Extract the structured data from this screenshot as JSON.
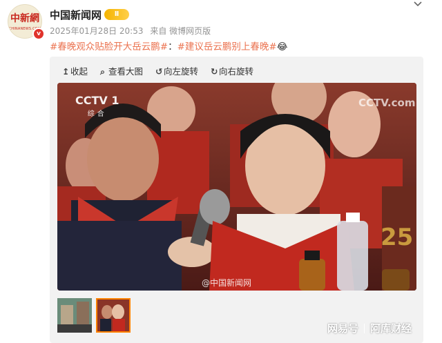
{
  "account": {
    "avatar_text": "中新網",
    "avatar_sub": "CHINANEWS.COM",
    "verified_mark": "v",
    "name": "中国新闻网",
    "member_badge": "Ⅱ",
    "timestamp": "2025年01月28日 20:53",
    "source": "来自 微博网页版"
  },
  "post": {
    "tag1": "#春晚观众贴脸开大岳云鹏#",
    "colon": "：",
    "tag2": "#建议岳云鹏别上春晚#",
    "emoji": "😂"
  },
  "toolbar": {
    "collapse_icon": "↥",
    "collapse_label": "收起",
    "view_large_icon": "⌕",
    "view_large_label": "查看大图",
    "rotate_left_icon": "↺",
    "rotate_left_label": "向左旋转",
    "rotate_right_icon": "↻",
    "rotate_right_label": "向右旋转"
  },
  "photo": {
    "channel_logo": "CCTV 1",
    "channel_sub": "综合",
    "channel_logo_right": "CCTV.com",
    "watermark": "@中国新闻网"
  },
  "footer": {
    "brand1": "网易号",
    "brand2": "阿库财经"
  },
  "colors": {
    "tag": "#eb7350",
    "verified": "#e0332b",
    "badge": "#f5b400",
    "thumb_selected": "#ff8200"
  },
  "icons": [
    "chevron-down-icon",
    "collapse-icon",
    "search-icon",
    "rotate-left-icon",
    "rotate-right-icon",
    "verified-icon",
    "member-badge-icon"
  ]
}
